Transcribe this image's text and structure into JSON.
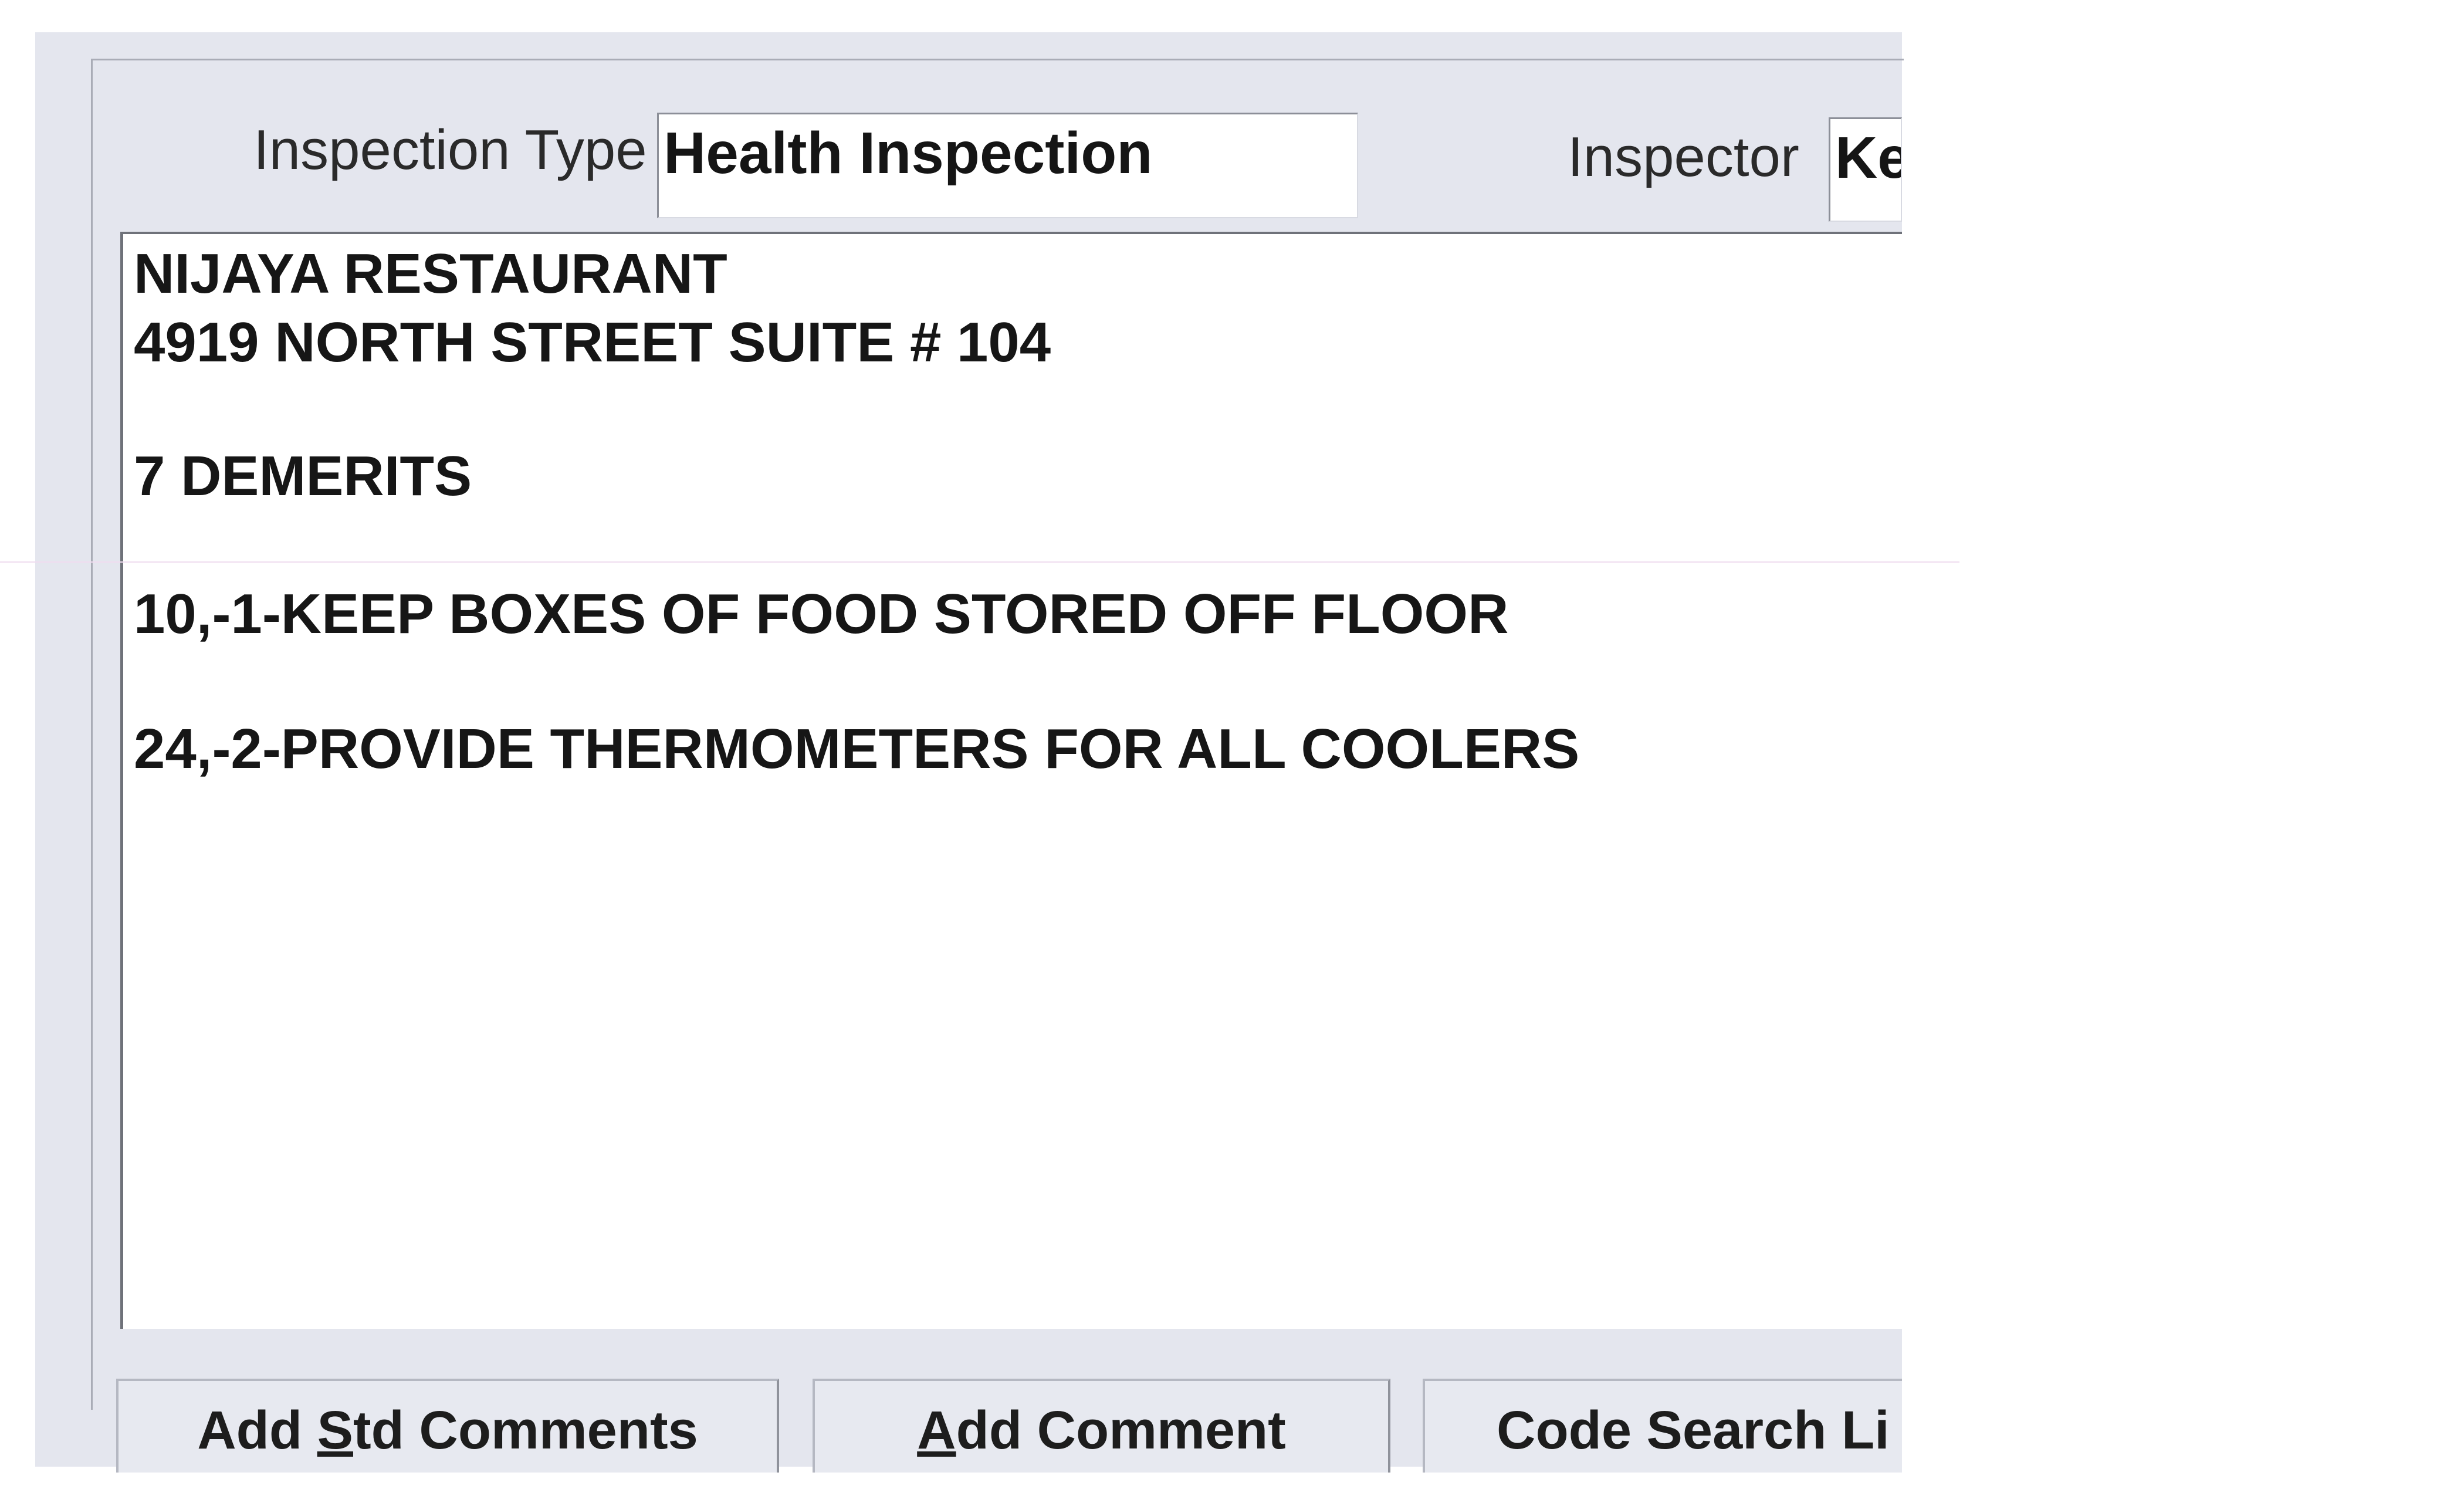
{
  "header": {
    "inspection_type_label": "Inspection Type",
    "inspection_type_value": "Health Inspection",
    "inspector_label": "Inspector",
    "inspector_value": "Ke"
  },
  "comments": {
    "lines": [
      "NIJAYA RESTAURANT",
      "4919 NORTH STREET SUITE # 104",
      "7 DEMERITS",
      "10,-1-KEEP BOXES OF FOOD STORED OFF FLOOR",
      "24,-2-PROVIDE THERMOMETERS FOR ALL COOLERS"
    ]
  },
  "buttons": {
    "add_std_comments": {
      "pre": "Add ",
      "mnemonic": "S",
      "post": "td Comments"
    },
    "add_comment": {
      "pre": "",
      "mnemonic": "A",
      "post": "dd Comment"
    },
    "code_search": {
      "label": "Code Search Li"
    }
  }
}
